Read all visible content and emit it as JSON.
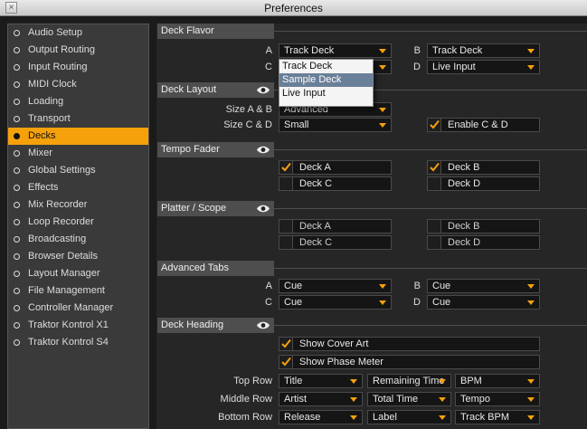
{
  "window": {
    "title": "Preferences",
    "close_glyph": "×"
  },
  "sidebar": {
    "items": [
      {
        "label": "Audio Setup"
      },
      {
        "label": "Output Routing"
      },
      {
        "label": "Input Routing"
      },
      {
        "label": "MIDI Clock"
      },
      {
        "label": "Loading"
      },
      {
        "label": "Transport"
      },
      {
        "label": "Decks",
        "selected": true
      },
      {
        "label": "Mixer"
      },
      {
        "label": "Global Settings"
      },
      {
        "label": "Effects"
      },
      {
        "label": "Mix Recorder"
      },
      {
        "label": "Loop Recorder"
      },
      {
        "label": "Broadcasting"
      },
      {
        "label": "Browser Details"
      },
      {
        "label": "Layout Manager"
      },
      {
        "label": "File Management"
      },
      {
        "label": "Controller Manager"
      },
      {
        "label": "Traktor Kontrol X1"
      },
      {
        "label": "Traktor Kontrol S4"
      }
    ]
  },
  "deck_flavor": {
    "title": "Deck Flavor",
    "label_a": "A",
    "value_a": "Track Deck",
    "label_b": "B",
    "value_b": "Track Deck",
    "label_c": "C",
    "label_d": "D",
    "value_d": "Live Input",
    "popup_options": [
      "Track Deck",
      "Sample Deck",
      "Live Input"
    ],
    "popup_selected": "Sample Deck"
  },
  "deck_layout": {
    "title": "Deck Layout",
    "size_ab_label": "Size A & B",
    "size_ab_value": "Advanced",
    "size_cd_label": "Size C & D",
    "size_cd_value": "Small",
    "enable_cd_label": "Enable C & D",
    "enable_cd_checked": true
  },
  "tempo_fader": {
    "title": "Tempo Fader",
    "deck_a": "Deck A",
    "deck_a_checked": true,
    "deck_b": "Deck B",
    "deck_b_checked": true,
    "deck_c": "Deck C",
    "deck_c_checked": false,
    "deck_d": "Deck D",
    "deck_d_checked": false
  },
  "platter_scope": {
    "title": "Platter / Scope",
    "deck_a": "Deck A",
    "deck_b": "Deck B",
    "deck_c": "Deck C",
    "deck_d": "Deck D"
  },
  "advanced_tabs": {
    "title": "Advanced Tabs",
    "label_a": "A",
    "value_a": "Cue",
    "label_b": "B",
    "value_b": "Cue",
    "label_c": "C",
    "value_c": "Cue",
    "label_d": "D",
    "value_d": "Cue"
  },
  "deck_heading": {
    "title": "Deck Heading",
    "show_cover_art": "Show Cover Art",
    "show_cover_art_checked": true,
    "show_phase_meter": "Show Phase Meter",
    "show_phase_meter_checked": true,
    "top_row_label": "Top Row",
    "top_row": [
      "Title",
      "Remaining Time",
      "BPM"
    ],
    "middle_row_label": "Middle Row",
    "middle_row": [
      "Artist",
      "Total Time",
      "Tempo"
    ],
    "bottom_row_label": "Bottom Row",
    "bottom_row": [
      "Release",
      "Label",
      "Track BPM"
    ]
  },
  "colors": {
    "accent": "#f5a10b",
    "panel": "#262626",
    "section_header": "#4e4e4e",
    "popup_highlight": "#6a7f98"
  }
}
